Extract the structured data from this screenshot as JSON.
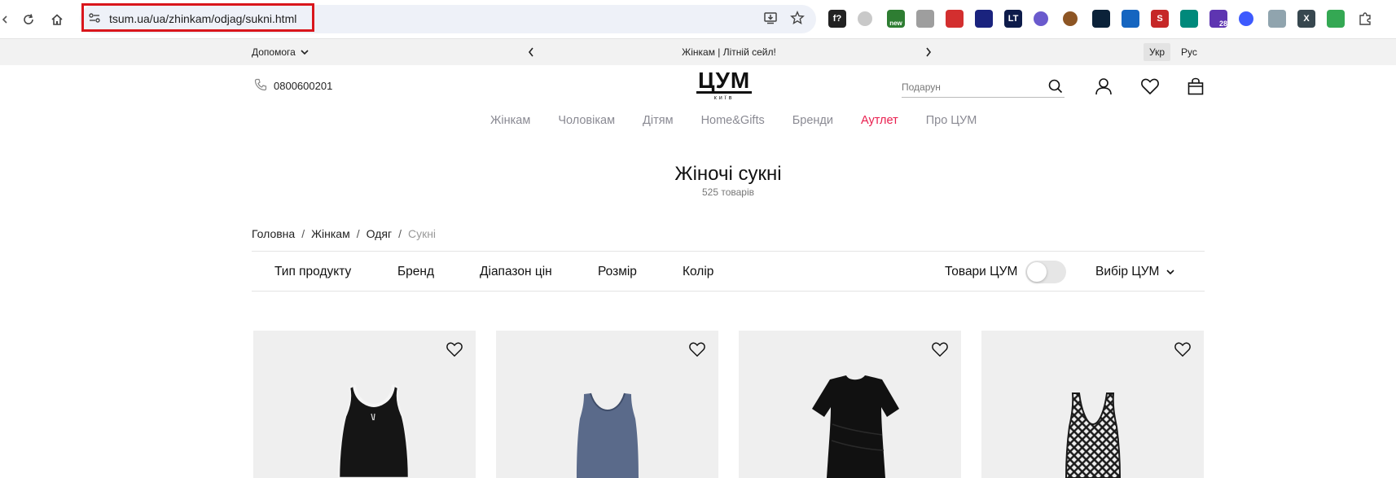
{
  "browser": {
    "url": "tsum.ua/ua/zhinkam/odjag/sukni.html",
    "extensions": [
      {
        "icon": "fx-icon",
        "color": "#222222",
        "label": "f?"
      },
      {
        "icon": "grey-circle-icon",
        "color": "#c9c9c9",
        "label": ""
      },
      {
        "icon": "new-badge-icon",
        "color": "#2e7d32",
        "label": "new"
      },
      {
        "icon": "camera-icon",
        "color": "#9e9e9e",
        "label": ""
      },
      {
        "icon": "checkbox-icon",
        "color": "#d32f2f",
        "label": ""
      },
      {
        "icon": "compass-icon",
        "color": "#1a237e",
        "label": ""
      },
      {
        "icon": "lt-icon",
        "color": "#0d1b4a",
        "label": "LT"
      },
      {
        "icon": "gear-circle-icon",
        "color": "#6a5acd",
        "label": ""
      },
      {
        "icon": "cookie-icon",
        "color": "#8d5524",
        "label": ""
      },
      {
        "icon": "hexagon-icon",
        "color": "#0b2239",
        "label": ""
      },
      {
        "icon": "info-circle-icon",
        "color": "#1565c0",
        "label": ""
      },
      {
        "icon": "s-icon",
        "color": "#c62828",
        "label": "S"
      },
      {
        "icon": "scan-icon",
        "color": "#00897b",
        "label": ""
      },
      {
        "icon": "grad-cap-icon",
        "color": "#5e35b1",
        "label": "28"
      },
      {
        "icon": "blue-dot-icon",
        "color": "#3d5afe",
        "label": ""
      },
      {
        "icon": "shield-icon",
        "color": "#90a4ae",
        "label": ""
      },
      {
        "icon": "x-icon",
        "color": "#37474f",
        "label": "X"
      },
      {
        "icon": "google-icon",
        "color": "#34a853",
        "label": ""
      },
      {
        "icon": "puzzle-icon",
        "color": "#444444",
        "label": ""
      }
    ]
  },
  "topbar": {
    "help": "Допомога",
    "promo": "Жінкам | Літній сейл!",
    "languages": [
      "Укр",
      "Рус"
    ],
    "active_language": "Укр"
  },
  "header": {
    "phone": "0800600201",
    "logo_main": "ЦУМ",
    "logo_sub": "київ",
    "search_placeholder": "Подарун"
  },
  "nav": {
    "items": [
      "Жінкам",
      "Чоловікам",
      "Дітям",
      "Home&Gifts",
      "Бренди",
      "Аутлет",
      "Про ЦУМ"
    ],
    "highlight_color": "#e91e4e"
  },
  "page": {
    "title": "Жіночі сукні",
    "count": "525 товарів"
  },
  "breadcrumbs": [
    "Головна",
    "Жінкам",
    "Одяг",
    "Сукні"
  ],
  "filters": {
    "items": [
      "Тип продукту",
      "Бренд",
      "Діапазон цін",
      "Розмір",
      "Колір"
    ],
    "tsum_goods": "Товари ЦУМ",
    "tsum_goods_enabled": false,
    "sort": "Вибір ЦУМ"
  },
  "products": [
    {
      "garment": "black-halter-dress",
      "color": "#151515"
    },
    {
      "garment": "blue-tank-dress",
      "color": "#5a6a8a"
    },
    {
      "garment": "black-tshirt-dress",
      "color": "#111111"
    },
    {
      "garment": "black-mesh-dress",
      "color": "#1a1a1a"
    }
  ]
}
